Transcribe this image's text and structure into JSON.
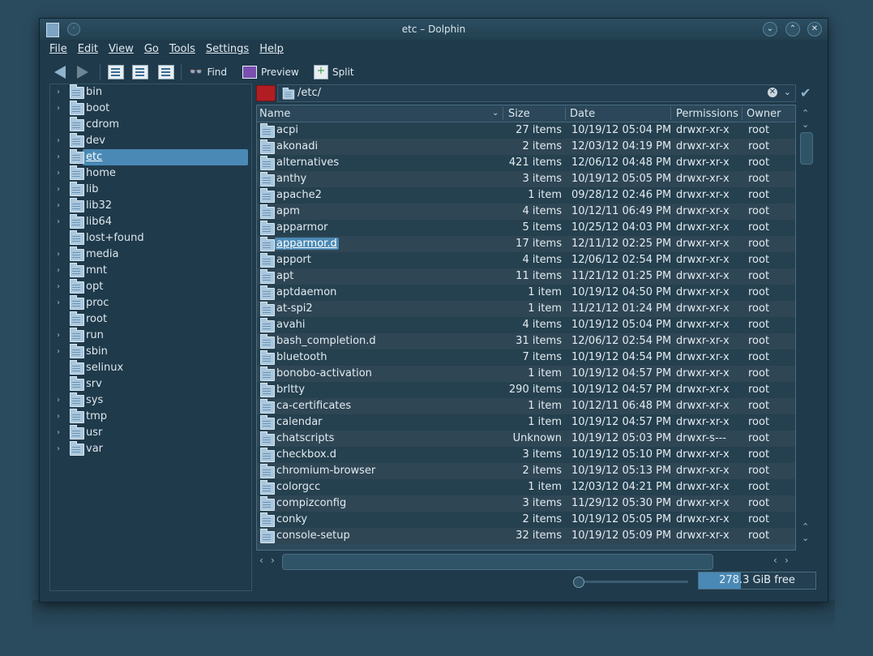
{
  "window": {
    "title": "etc – Dolphin"
  },
  "menubar": [
    "File",
    "Edit",
    "View",
    "Go",
    "Tools",
    "Settings",
    "Help"
  ],
  "toolbar": {
    "find": "Find",
    "preview": "Preview",
    "split": "Split"
  },
  "location": {
    "path": "/etc/"
  },
  "tree": [
    {
      "label": "bin",
      "expandable": true
    },
    {
      "label": "boot",
      "expandable": true
    },
    {
      "label": "cdrom",
      "expandable": false
    },
    {
      "label": "dev",
      "expandable": true
    },
    {
      "label": "etc",
      "expandable": true,
      "selected": true
    },
    {
      "label": "home",
      "expandable": true
    },
    {
      "label": "lib",
      "expandable": true
    },
    {
      "label": "lib32",
      "expandable": true
    },
    {
      "label": "lib64",
      "expandable": true
    },
    {
      "label": "lost+found",
      "expandable": false
    },
    {
      "label": "media",
      "expandable": true
    },
    {
      "label": "mnt",
      "expandable": true
    },
    {
      "label": "opt",
      "expandable": true
    },
    {
      "label": "proc",
      "expandable": true
    },
    {
      "label": "root",
      "expandable": false
    },
    {
      "label": "run",
      "expandable": true
    },
    {
      "label": "sbin",
      "expandable": true
    },
    {
      "label": "selinux",
      "expandable": false
    },
    {
      "label": "srv",
      "expandable": false
    },
    {
      "label": "sys",
      "expandable": true
    },
    {
      "label": "tmp",
      "expandable": true
    },
    {
      "label": "usr",
      "expandable": true
    },
    {
      "label": "var",
      "expandable": true
    }
  ],
  "columns": {
    "name": "Name",
    "size": "Size",
    "date": "Date",
    "permissions": "Permissions",
    "owner": "Owner"
  },
  "files": [
    {
      "name": "acpi",
      "size": "27 items",
      "date": "10/19/12 05:04 PM",
      "perm": "drwxr-xr-x",
      "owner": "root"
    },
    {
      "name": "akonadi",
      "size": "2 items",
      "date": "12/03/12 04:19 PM",
      "perm": "drwxr-xr-x",
      "owner": "root"
    },
    {
      "name": "alternatives",
      "size": "421 items",
      "date": "12/06/12 04:48 PM",
      "perm": "drwxr-xr-x",
      "owner": "root"
    },
    {
      "name": "anthy",
      "size": "3 items",
      "date": "10/19/12 05:05 PM",
      "perm": "drwxr-xr-x",
      "owner": "root"
    },
    {
      "name": "apache2",
      "size": "1 item",
      "date": "09/28/12 02:46 PM",
      "perm": "drwxr-xr-x",
      "owner": "root"
    },
    {
      "name": "apm",
      "size": "4 items",
      "date": "10/12/11 06:49 PM",
      "perm": "drwxr-xr-x",
      "owner": "root"
    },
    {
      "name": "apparmor",
      "size": "5 items",
      "date": "10/25/12 04:03 PM",
      "perm": "drwxr-xr-x",
      "owner": "root"
    },
    {
      "name": "apparmor.d",
      "size": "17 items",
      "date": "12/11/12 02:25 PM",
      "perm": "drwxr-xr-x",
      "owner": "root",
      "selected": true
    },
    {
      "name": "apport",
      "size": "4 items",
      "date": "12/06/12 02:54 PM",
      "perm": "drwxr-xr-x",
      "owner": "root"
    },
    {
      "name": "apt",
      "size": "11 items",
      "date": "11/21/12 01:25 PM",
      "perm": "drwxr-xr-x",
      "owner": "root"
    },
    {
      "name": "aptdaemon",
      "size": "1 item",
      "date": "10/19/12 04:50 PM",
      "perm": "drwxr-xr-x",
      "owner": "root"
    },
    {
      "name": "at-spi2",
      "size": "1 item",
      "date": "11/21/12 01:24 PM",
      "perm": "drwxr-xr-x",
      "owner": "root"
    },
    {
      "name": "avahi",
      "size": "4 items",
      "date": "10/19/12 05:04 PM",
      "perm": "drwxr-xr-x",
      "owner": "root"
    },
    {
      "name": "bash_completion.d",
      "size": "31 items",
      "date": "12/06/12 02:54 PM",
      "perm": "drwxr-xr-x",
      "owner": "root"
    },
    {
      "name": "bluetooth",
      "size": "7 items",
      "date": "10/19/12 04:54 PM",
      "perm": "drwxr-xr-x",
      "owner": "root"
    },
    {
      "name": "bonobo-activation",
      "size": "1 item",
      "date": "10/19/12 04:57 PM",
      "perm": "drwxr-xr-x",
      "owner": "root"
    },
    {
      "name": "brltty",
      "size": "290 items",
      "date": "10/19/12 04:57 PM",
      "perm": "drwxr-xr-x",
      "owner": "root"
    },
    {
      "name": "ca-certificates",
      "size": "1 item",
      "date": "10/12/11 06:48 PM",
      "perm": "drwxr-xr-x",
      "owner": "root"
    },
    {
      "name": "calendar",
      "size": "1 item",
      "date": "10/19/12 04:57 PM",
      "perm": "drwxr-xr-x",
      "owner": "root"
    },
    {
      "name": "chatscripts",
      "size": "Unknown",
      "date": "10/19/12 05:03 PM",
      "perm": "drwxr-s---",
      "owner": "root"
    },
    {
      "name": "checkbox.d",
      "size": "3 items",
      "date": "10/19/12 05:10 PM",
      "perm": "drwxr-xr-x",
      "owner": "root"
    },
    {
      "name": "chromium-browser",
      "size": "2 items",
      "date": "10/19/12 05:13 PM",
      "perm": "drwxr-xr-x",
      "owner": "root"
    },
    {
      "name": "colorgcc",
      "size": "1 item",
      "date": "12/03/12 04:21 PM",
      "perm": "drwxr-xr-x",
      "owner": "root"
    },
    {
      "name": "compizconfig",
      "size": "3 items",
      "date": "11/29/12 05:30 PM",
      "perm": "drwxr-xr-x",
      "owner": "root"
    },
    {
      "name": "conky",
      "size": "2 items",
      "date": "10/19/12 05:05 PM",
      "perm": "drwxr-xr-x",
      "owner": "root"
    },
    {
      "name": "console-setup",
      "size": "32 items",
      "date": "10/19/12 05:09 PM",
      "perm": "drwxr-xr-x",
      "owner": "root"
    }
  ],
  "status": {
    "free_space": "278.3 GiB free",
    "used_fraction": 0.36
  }
}
